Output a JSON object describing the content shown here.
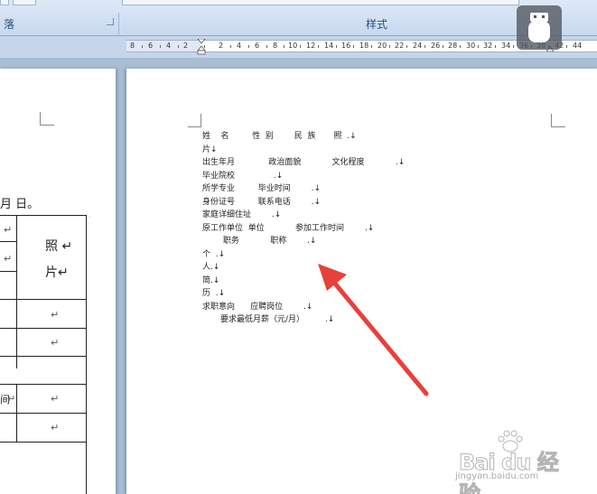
{
  "ribbon": {
    "left_group_label": "落",
    "style_group_label": "样式"
  },
  "ruler": {
    "numbers": [
      "8",
      "6",
      "4",
      "2",
      "2",
      "4",
      "6",
      "8",
      "10",
      "12",
      "14",
      "16",
      "18",
      "20",
      "22",
      "24",
      "26",
      "28",
      "30",
      "32",
      "34",
      "36",
      "38",
      "42",
      "44"
    ]
  },
  "left_page": {
    "date_text": "月    日。",
    "photo_label_1": "照 ↵",
    "photo_label_2": "片↵",
    "cell_mark": "↵",
    "partial_cell": "间"
  },
  "right_page": {
    "lines": [
      "姓    名         性  别        民  族       照  .↓",
      "片↓",
      "出生年月             政治面貌            文化程度            .↓",
      "毕业院校               .↓",
      "所学专业         毕业时间        .↓",
      "身份证号         联系电话        .↓",
      "家庭详细住址        .↓",
      "原工作单位  单位            参加工作时间        .↓",
      "        职务            职称        .↓",
      "个  .↓",
      "人.↓",
      "简.↓",
      "历  .↓",
      "求职意向      应聘岗位        .↓",
      "       要求最低月薪（元/月）        .↓"
    ]
  },
  "watermark": {
    "brand": "Bai du 经验",
    "url": "jingyan.baidu.com"
  },
  "colors": {
    "arrow": "#e8403a",
    "ribbon": "#c7d9ef",
    "workspace": "#a9bdd5"
  }
}
